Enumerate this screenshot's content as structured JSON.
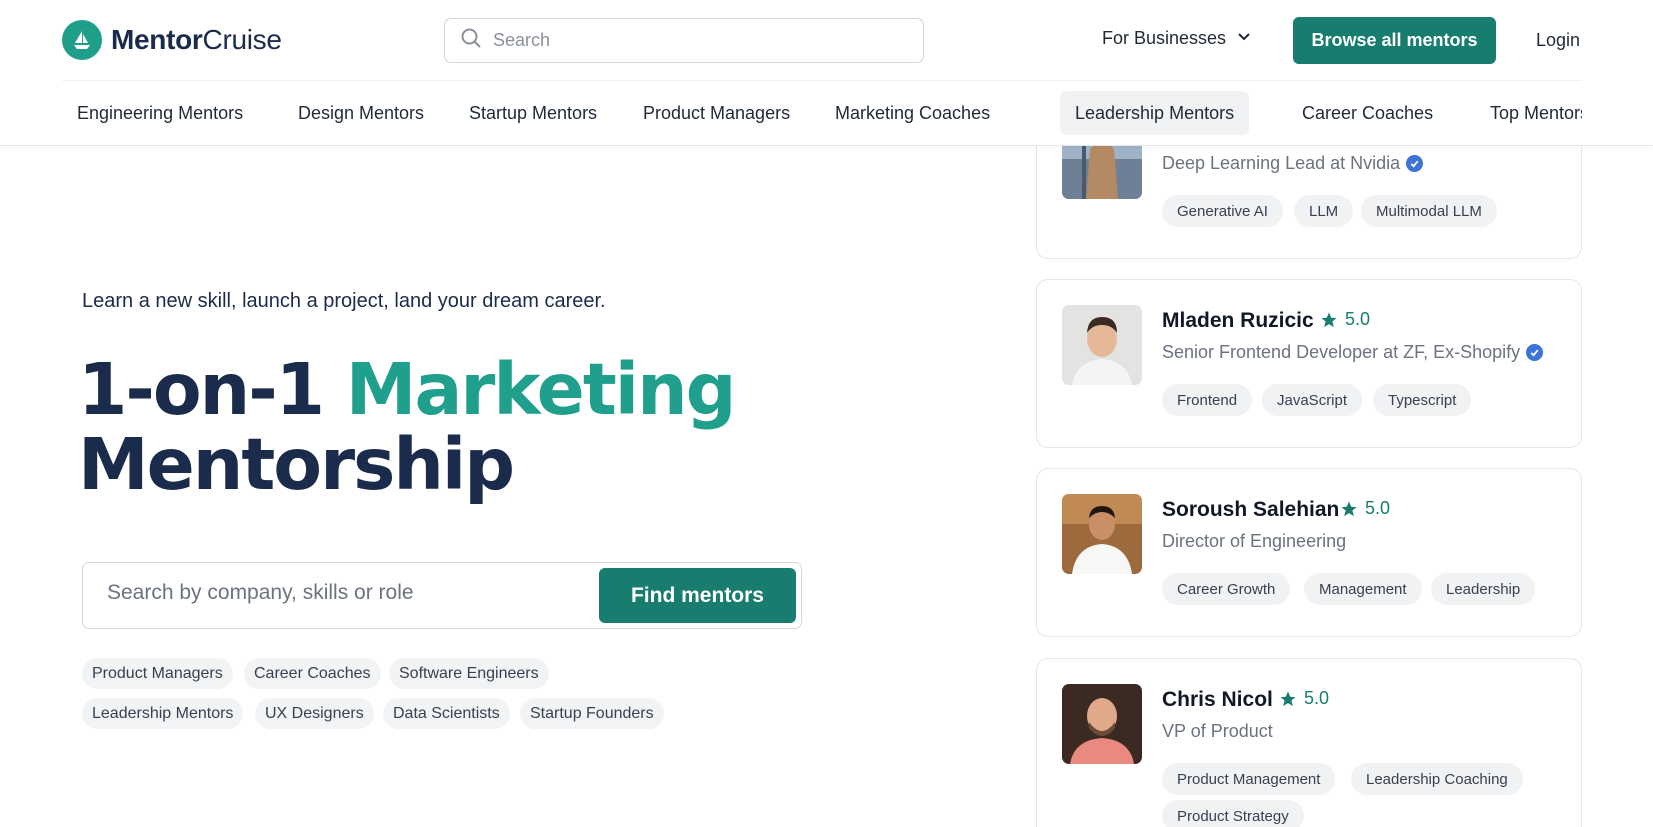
{
  "header": {
    "logo": {
      "bold": "Mentor",
      "regular": "Cruise"
    },
    "search_placeholder": "Search",
    "for_businesses": "For Businesses",
    "browse_button": "Browse all mentors",
    "login": "Login"
  },
  "nav": {
    "items": [
      {
        "label": "Engineering Mentors"
      },
      {
        "label": "Design Mentors"
      },
      {
        "label": "Startup Mentors"
      },
      {
        "label": "Product Managers"
      },
      {
        "label": "Marketing Coaches"
      },
      {
        "label": "Leadership Mentors",
        "active": true
      },
      {
        "label": "Career Coaches"
      },
      {
        "label": "Top Mentors"
      }
    ]
  },
  "hero": {
    "tagline": "Learn a new skill, launch a project, land your dream career.",
    "title_part1": "1-on-1",
    "title_accent": "Marketing",
    "title_part2": "Mentorship",
    "search_placeholder": "Search by company, skills or role",
    "find_button": "Find mentors",
    "chips": [
      "Product Managers",
      "Career Coaches",
      "Software Engineers",
      "Leadership Mentors",
      "UX Designers",
      "Data Scientists",
      "Startup Founders"
    ]
  },
  "mentors": [
    {
      "name": "",
      "rating": "",
      "role": "Deep Learning Lead at Nvidia",
      "verified": true,
      "tags": [
        "Generative AI",
        "LLM",
        "Multimodal LLM"
      ]
    },
    {
      "name": "Mladen Ruzicic",
      "rating": "5.0",
      "role": "Senior Frontend Developer at ZF, Ex-Shopify",
      "verified": true,
      "tags": [
        "Frontend",
        "JavaScript",
        "Typescript"
      ]
    },
    {
      "name": "Soroush Salehian",
      "rating": "5.0",
      "role": "Director of Engineering",
      "verified": false,
      "tags": [
        "Career Growth",
        "Management",
        "Leadership"
      ]
    },
    {
      "name": "Chris Nicol",
      "rating": "5.0",
      "role": "VP of Product",
      "verified": false,
      "tags": [
        "Product Management",
        "Leadership Coaching",
        "Product Strategy"
      ]
    }
  ],
  "colors": {
    "brand": "#187d6e",
    "accent": "#20a08c",
    "navy": "#1b2b4b",
    "verified": "#3b74d4"
  },
  "icons": [
    "sailboat-logo-icon",
    "search-icon",
    "chevron-down-icon",
    "star-icon",
    "verified-badge-icon"
  ]
}
